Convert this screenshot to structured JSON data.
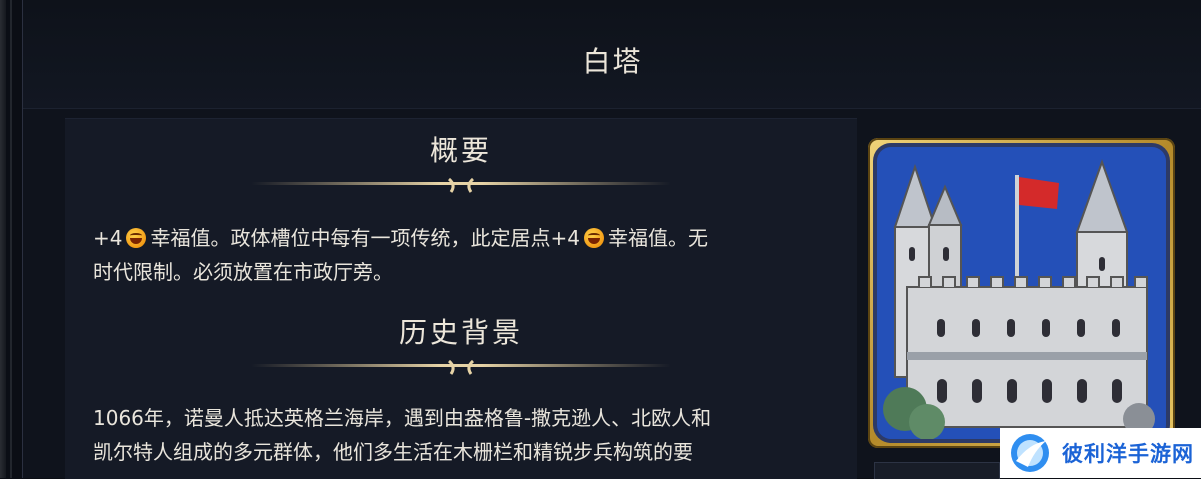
{
  "title": "白塔",
  "summary": {
    "heading": "概要",
    "line1_part1": "+4",
    "line1_part2": "幸福值。政体槽位中每有一项传统，此定居点+4",
    "line1_part3": "幸福值。无",
    "line2": "时代限制。必须放置在市政厅旁。",
    "icon": "happiness-emoji-icon"
  },
  "history": {
    "heading": "历史背景",
    "line1": "1066年，诺曼人抵达英格兰海岸，遇到由盎格鲁-撒克逊人、北欧人和",
    "line2": "凯尔特人组成的多元群体，他们多生活在木栅栏和精锐步兵构筑的要"
  },
  "image": {
    "subject": "white-tower-icon",
    "flag_color": "#d42a2a",
    "sky_color": "#2450b8",
    "frame_color": "#d8b24a"
  },
  "watermark": {
    "text": "彼利洋手游网"
  }
}
